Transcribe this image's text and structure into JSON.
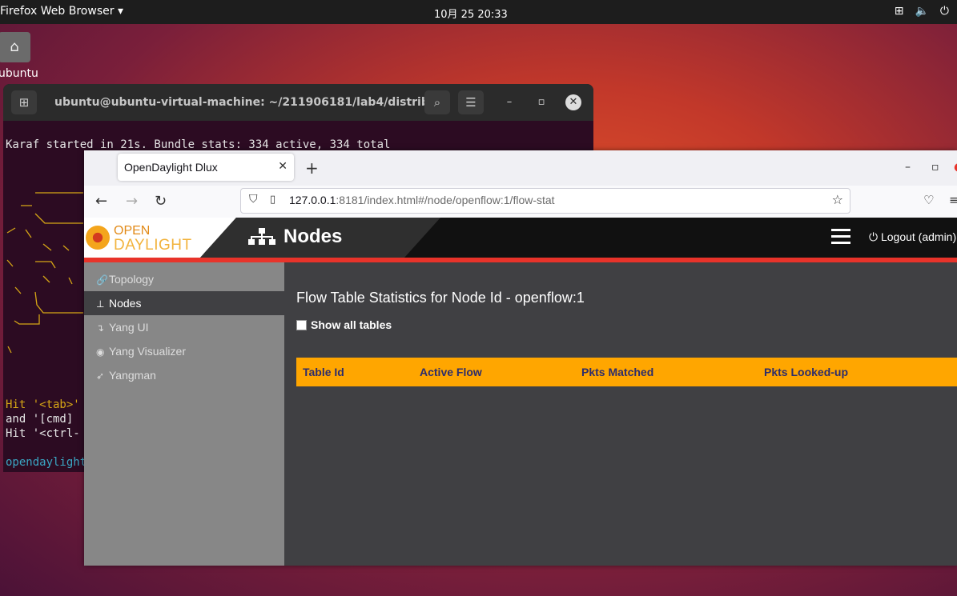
{
  "topbar": {
    "app_name": "Firefox Web Browser ▾",
    "clock": "10月 25  20:33",
    "tray_icons": [
      "network-icon",
      "volume-icon",
      "power-icon"
    ]
  },
  "desktop": {
    "home_label": "ubuntu"
  },
  "terminal": {
    "title": "ubuntu@ubuntu-virtual-machine: ~/211906181/lab4/distribu...",
    "line1": "Karaf started in 21s. Bundle stats: 334 active, 334 total",
    "hit_tab": "Hit '<tab>'",
    "and_cmd": "and '[cmd]",
    "hit_ctrl": "Hit '<ctrl-",
    "prompt": "opendaylight"
  },
  "browser": {
    "tab_title": "OpenDaylight Dlux",
    "url_host": "127.0.0.1",
    "url_rest": ":8181/index.html#/node/openflow:1/flow-stat"
  },
  "odl": {
    "logo_open": "OPEN",
    "logo_daylight": "DAYLIGHT",
    "section_title": "Nodes",
    "logout": "Logout (admin)"
  },
  "sidebar": {
    "items": [
      {
        "label": "Topology",
        "icon": "link-icon"
      },
      {
        "label": "Nodes",
        "icon": "sitemap-icon"
      },
      {
        "label": "Yang UI",
        "icon": "level-down-icon"
      },
      {
        "label": "Yang Visualizer",
        "icon": "eye-icon"
      },
      {
        "label": "Yangman",
        "icon": "rocket-icon"
      }
    ],
    "active_index": 1
  },
  "content": {
    "heading": "Flow Table Statistics for Node Id - openflow:1",
    "checkbox_label": "Show all tables",
    "checkbox_checked": false,
    "table_headers": [
      "Table Id",
      "Active Flow",
      "Pkts Matched",
      "Pkts Looked-up"
    ],
    "header_color": "#ffa600"
  }
}
